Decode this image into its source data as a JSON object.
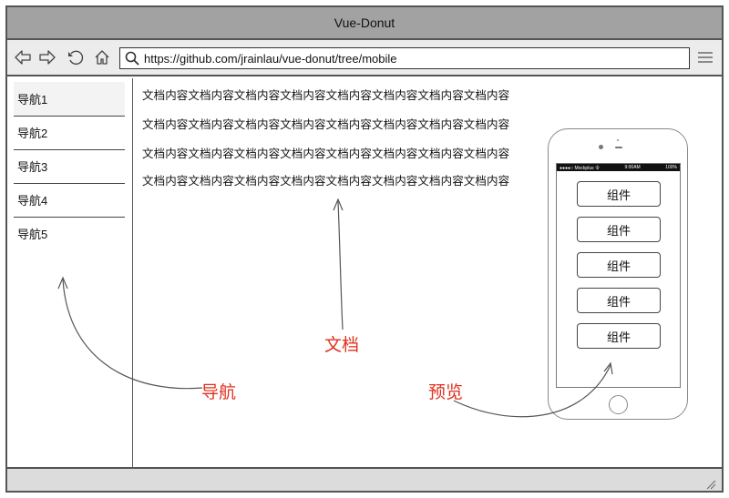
{
  "window": {
    "title": "Vue-Donut"
  },
  "toolbar": {
    "url": "https://github.com/jrainlau/vue-donut/tree/mobile",
    "icons": [
      "back-icon",
      "forward-icon",
      "reload-icon",
      "home-icon",
      "search-icon",
      "hamburger-menu-icon"
    ]
  },
  "sidebar": {
    "items": [
      {
        "label": "导航1"
      },
      {
        "label": "导航2"
      },
      {
        "label": "导航3"
      },
      {
        "label": "导航4"
      },
      {
        "label": "导航5"
      }
    ]
  },
  "document": {
    "lines": [
      "文档内容文档内容文档内容文档内容文档内容文档内容文档内容文档内容",
      "文档内容文档内容文档内容文档内容文档内容文档内容文档内容文档内容",
      "文档内容文档内容文档内容文档内容文档内容文档内容文档内容文档内容",
      "文档内容文档内容文档内容文档内容文档内容文档内容文档内容文档内容"
    ]
  },
  "phone": {
    "status_left": "●●●●○ Mockplus 令",
    "status_time": "9:00AM",
    "status_right": "100%",
    "components": [
      "组件",
      "组件",
      "组件",
      "组件",
      "组件"
    ]
  },
  "annotations": {
    "nav": "导航",
    "doc": "文档",
    "preview": "预览",
    "color": "#e0301e"
  }
}
